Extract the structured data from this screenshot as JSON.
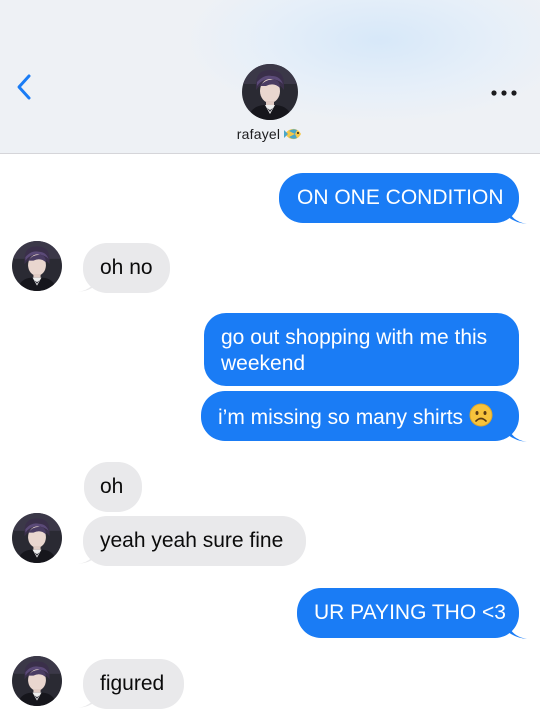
{
  "header": {
    "contact_name": "rafayel"
  },
  "icons": {
    "back": "chevron-left-icon",
    "more": "ellipsis-icon",
    "name_badge": "fish-icon",
    "sad_face": "frowning-face-emoji"
  },
  "colors": {
    "outgoing_bubble": "#1a7cf5",
    "incoming_bubble": "#e9e9eb",
    "accent": "#1a7cf5"
  },
  "messages": [
    {
      "from": "me",
      "text": "ON ONE CONDITION"
    },
    {
      "from": "rafayel",
      "text": "oh no"
    },
    {
      "from": "me",
      "text": "go out shopping with me this weekend"
    },
    {
      "from": "me",
      "text": "i’m missing so many shirts"
    },
    {
      "from": "rafayel",
      "text": "oh"
    },
    {
      "from": "rafayel",
      "text": "yeah yeah sure fine"
    },
    {
      "from": "me",
      "text": "UR PAYING THO <3"
    },
    {
      "from": "rafayel",
      "text": "figured"
    }
  ]
}
